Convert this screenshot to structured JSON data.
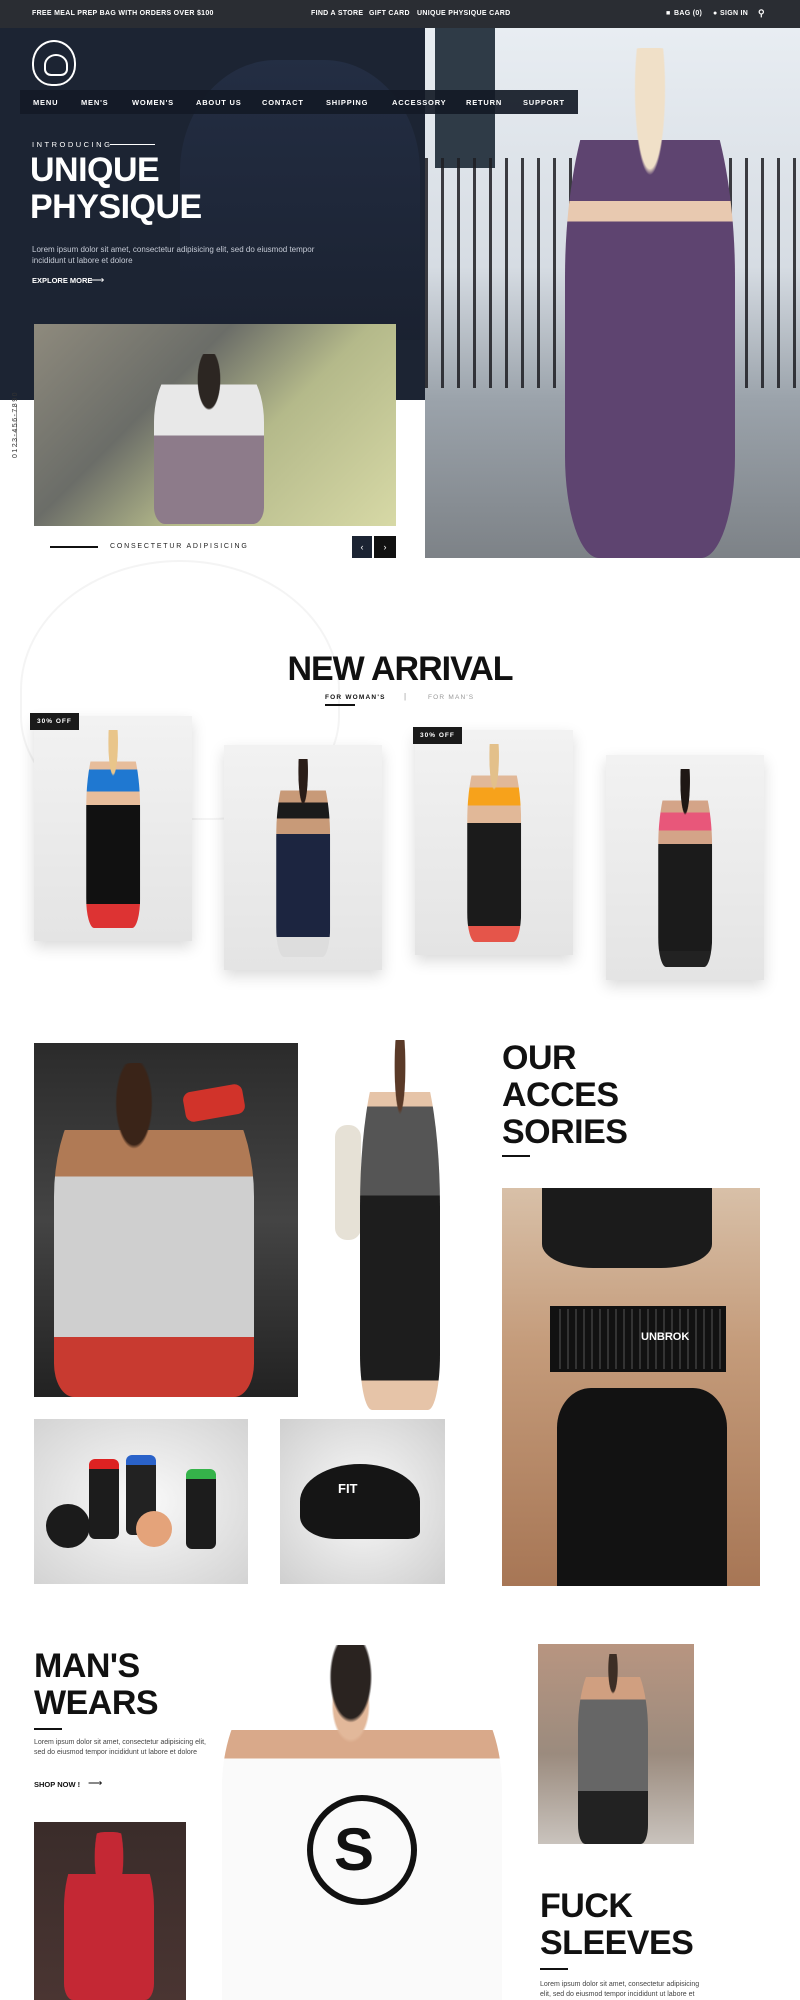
{
  "topbar": {
    "promo": "FREE MEAL PREP BAG WITH ORDERS OVER $100",
    "links": [
      "FIND A STORE",
      "GIFT CARD",
      "UNIQUE PHYSIQUE CARD"
    ],
    "bag": "BAG (0)",
    "signin": "SIGN IN"
  },
  "nav": [
    "MENU",
    "MEN'S",
    "WOMEN'S",
    "ABOUT US",
    "CONTACT",
    "SHIPPING",
    "ACCESSORY",
    "RETURN",
    "SUPPORT"
  ],
  "hero": {
    "eyebrow": "INTRODUCING",
    "title_line1": "UNIQUE",
    "title_line2": "PHYSIQUE",
    "text": "Lorem ipsum dolor sit amet, consectetur adipisicing elit, sed do eiusmod tempor incididunt ut labore et dolore",
    "cta": "EXPLORE MORE",
    "phone": "0123-456-7890",
    "slide_caption": "CONSECTETUR ADIPISICING"
  },
  "new_arrival": {
    "title": "NEW ARRIVAL",
    "tab_active": "FOR WOMAN'S",
    "tab_inactive": "FOR MAN'S",
    "products": [
      {
        "badge": "30% OFF",
        "top": "#1f78d1",
        "bottom": "#111111"
      },
      {
        "badge": "",
        "top": "#1b1b1b",
        "bottom": "#1c2540"
      },
      {
        "badge": "30% OFF",
        "top": "#f7a21b",
        "bottom": "#1b1b1b"
      },
      {
        "badge": "",
        "top": "#e8577a",
        "bottom": "#1b1b1b"
      }
    ]
  },
  "accessories": {
    "title_line1": "OUR",
    "title_line2": "ACCES",
    "title_line3": "SORIES",
    "belt_label": "UNBROK",
    "cap_label": "FIT"
  },
  "mens_wears": {
    "title_line1": "MAN'S",
    "title_line2": "WEARS",
    "text": "Lorem ipsum dolor sit amet, consectetur adipisicing elit, sed do eiusmod tempor incididunt ut labore et dolore",
    "cta": "SHOP NOW !"
  },
  "sleeves": {
    "title_line1": "FUCK",
    "title_line2": "SLEEVES",
    "text": "Lorem ipsum dolor sit amet, consectetur adipisicing elit, sed do eiusmod tempor incididunt ut labore et"
  }
}
